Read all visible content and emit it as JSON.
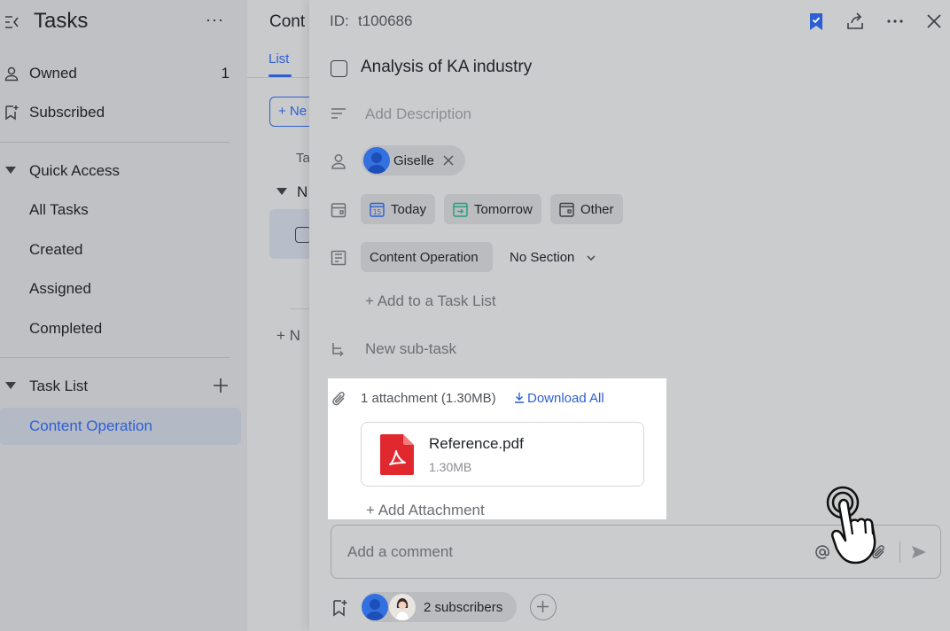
{
  "sidebar": {
    "title": "Tasks",
    "more": "···",
    "owned": {
      "label": "Owned",
      "count": "1"
    },
    "subscribed": "Subscribed",
    "quick_access": "Quick Access",
    "quick_items": [
      "All Tasks",
      "Created",
      "Assigned",
      "Completed"
    ],
    "task_list": "Task List",
    "active_list": "Content Operation"
  },
  "middle": {
    "title": "Cont",
    "tab": "List",
    "new_button": "+ Ne",
    "column": "Ta",
    "group": "N",
    "add_new": "+ N"
  },
  "detail": {
    "id_label": "ID:",
    "id_value": "t100686",
    "title": "Analysis of KA industry",
    "description_placeholder": "Add Description",
    "assignee": "Giselle",
    "dates": [
      "Today",
      "Tomorrow",
      "Other"
    ],
    "today_day": "15",
    "tasklist": "Content Operation",
    "section": "No Section",
    "add_tasklist": "+ Add to a Task List",
    "subtask": "New sub-task",
    "attachments": {
      "count": "1 attachment (1.30MB)",
      "download_all": "Download All",
      "file_name": "Reference.pdf",
      "file_size": "1.30MB",
      "add": "+ Add Attachment"
    },
    "comment_placeholder": "Add a comment",
    "subscribers": "2 subscribers"
  },
  "colors": {
    "accent": "#2d5fd3",
    "pdf_red": "#e0282e",
    "sidebar_bg": "#bfc1c4",
    "detail_bg": "#cbcccd"
  }
}
